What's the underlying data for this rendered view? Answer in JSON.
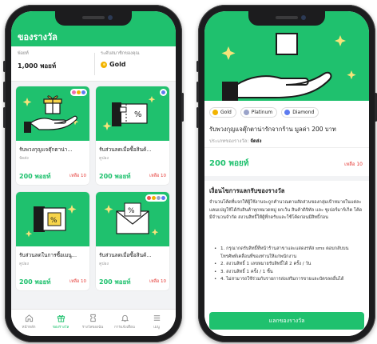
{
  "left": {
    "header_title": "ของรางวัล",
    "points": {
      "label": "พ้อยท์",
      "value": "1,000 พอยท์",
      "tier_label": "ระดับสมาชิกของคุณ",
      "tier_value": "Gold"
    },
    "cards": [
      {
        "name": "รับพวงกุญแจตุ๊กตาน่า...",
        "category": "จัดส่ง",
        "price": "200 พอยท์",
        "remaining": "เหลือ 10",
        "illustration": "gift-hand-illustration"
      },
      {
        "name": "รับส่วนลดเมื่อซื้อสินค้...",
        "category": "คูปอง",
        "price": "200 พอยท์",
        "remaining": "เหลือ 10",
        "illustration": "coupon-hand-illustration"
      },
      {
        "name": "รับส่วนลดในการซื้อเมนู...",
        "category": "คูปอง",
        "price": "200 พอยท์",
        "remaining": "เหลือ 10",
        "illustration": "percent-coupon-illustration"
      },
      {
        "name": "รับส่วนลดเมื่อซื้อสินค้...",
        "category": "คูปอง",
        "price": "200 พอยท์",
        "remaining": "เหลือ 10",
        "illustration": "envelope-illustration"
      }
    ],
    "tabs": [
      {
        "label": "หน้าหลัก",
        "icon": "home-icon"
      },
      {
        "label": "ของรางวัล",
        "icon": "gift-icon"
      },
      {
        "label": "รางวัลของฉัน",
        "icon": "ticket-icon"
      },
      {
        "label": "การแจ้งเตือน",
        "icon": "bell-icon"
      },
      {
        "label": "เมนู",
        "icon": "menu-icon"
      }
    ]
  },
  "right": {
    "tiers": [
      {
        "label": "Gold",
        "color": "#f2b300"
      },
      {
        "label": "Platinum",
        "color": "#9aa3c9"
      },
      {
        "label": "Diamond",
        "color": "#5d7bf0"
      }
    ],
    "reward_name": "รับพวงกุญแจตุ๊กตาน่ารักจากร้าน มูลค่า 200 บาท",
    "category_label": "ประเภทของรางวัล:",
    "category_value": "จัดส่ง",
    "price": "200 พอยท์",
    "remaining": "เหลือ 10",
    "conditions_title": "เงื่อนไขการแลกรับของรางวัล",
    "conditions_text": "จำนวนโค้ดที่แจกให้ผู้ใช้งานจะถูกคำนวณตามสัดส่วนของกลุ่มเป้าหมายในแต่ละแคมเปญใช้ได้กับสินค้าทุกหมวดหมู่ ยกเว้น สินค้าดิจิทัล และ ซูเปอร์มาร์เก็ต โค้ดมีจำนวนจำกัด สงวนสิทธิ์ให้ผู้ที่กดรับและใช้โค้ดก่อนมีสิทธิ์ก่อน",
    "conditions_list": [
      "1. กรุณากดรับสิทธิ์ที่หน้าร้านสาขาและแสดงรหัส sms ตอบกลับบน โทรศัพท์เคลื่อนที่ของท่านให้แก่พนักงาน",
      "2. สงวนสิทธิ์ 1 เลขหมายรับสิทธิ์ได้ 2 ครั้ง / วัน",
      "3. สงวนสิทธิ์ 1 ครั้ง / 1 ชิ้น",
      "4. ไม่สามารถใช้ร่วมกับรายการส่งเสริมการขายและบัตรลดอื่นได้"
    ],
    "cta_label": "แลกของรางวัล"
  },
  "colors": {
    "brand_green": "#1fc16e",
    "alert_red": "#e53935",
    "gold": "#f2b300"
  }
}
